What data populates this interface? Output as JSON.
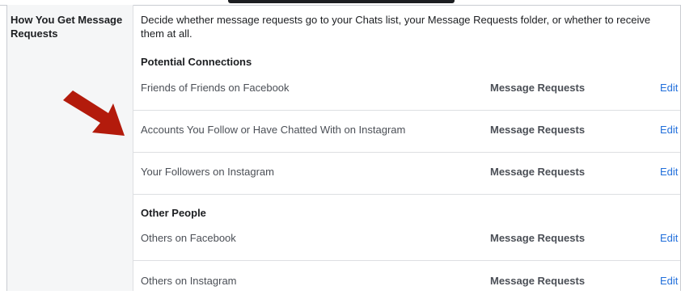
{
  "setting": {
    "label": "How You Get Message Requests",
    "description": "Decide whether message requests go to your Chats list, your Message Requests folder, or whether to receive them at all."
  },
  "sections": [
    {
      "title": "Potential Connections",
      "rows": [
        {
          "name": "Friends of Friends on Facebook",
          "value": "Message Requests",
          "action": "Edit"
        },
        {
          "name": "Accounts You Follow or Have Chatted With on Instagram",
          "value": "Message Requests",
          "action": "Edit"
        },
        {
          "name": "Your Followers on Instagram",
          "value": "Message Requests",
          "action": "Edit"
        }
      ]
    },
    {
      "title": "Other People",
      "rows": [
        {
          "name": "Others on Facebook",
          "value": "Message Requests",
          "action": "Edit"
        },
        {
          "name": "Others on Instagram",
          "value": "Message Requests",
          "action": "Edit"
        }
      ]
    }
  ],
  "colors": {
    "link": "#216fdb",
    "arrow": "#b31b0c"
  }
}
